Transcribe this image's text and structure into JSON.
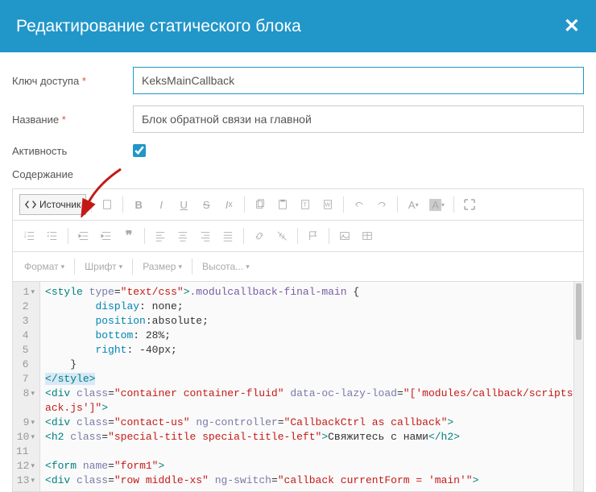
{
  "header": {
    "title": "Редактирование статического блока"
  },
  "fields": {
    "accessKey": {
      "label": "Ключ доступа",
      "required": true,
      "value": "KeksMainCallback"
    },
    "name": {
      "label": "Название",
      "required": true,
      "value": "Блок обратной связи на главной"
    },
    "active": {
      "label": "Активность",
      "checked": true
    },
    "content": {
      "label": "Содержание"
    }
  },
  "toolbar": {
    "source": "Источник",
    "format": "Формат",
    "font": "Шрифт",
    "size": "Размер",
    "height": "Высота..."
  },
  "code": {
    "lines": [
      {
        "n": "1",
        "fold": true,
        "html": "<span class='c-tag'>&lt;style</span> <span class='c-attr'>type</span>=<span class='c-str'>\"text/css\"</span><span class='c-tag'>&gt;</span><span class='c-sel2'>.modulcallback-final-main</span> {"
      },
      {
        "n": "2",
        "html": "        <span class='c-prop'>display</span>: none;"
      },
      {
        "n": "3",
        "html": "        <span class='c-prop'>position</span>:absolute;"
      },
      {
        "n": "4",
        "html": "        <span class='c-prop'>bottom</span>: 28%;"
      },
      {
        "n": "5",
        "html": "        <span class='c-prop'>right</span>: -40px;"
      },
      {
        "n": "6",
        "html": "    }"
      },
      {
        "n": "7",
        "html": "<span class='sel'><span class='c-tag'>&lt;/style&gt;</span></span>"
      },
      {
        "n": "8",
        "fold": true,
        "html": "<span class='c-tag'>&lt;div</span> <span class='c-attr'>class</span>=<span class='c-str'>\"container container-fluid\"</span> <span class='c-attr'>data-oc-lazy-load</span>=<span class='c-str'>\"['modules/callback/scripts/callb</span>"
      },
      {
        "n": "",
        "html": "<span class='c-str'>ack.js']\"</span><span class='c-tag'>&gt;</span>"
      },
      {
        "n": "9",
        "fold": true,
        "html": "<span class='c-tag'>&lt;div</span> <span class='c-attr'>class</span>=<span class='c-str'>\"contact-us\"</span> <span class='c-attr'>ng-controller</span>=<span class='c-str'>\"CallbackCtrl as callback\"</span><span class='c-tag'>&gt;</span>"
      },
      {
        "n": "10",
        "fold": true,
        "html": "<span class='c-tag'>&lt;h2</span> <span class='c-attr'>class</span>=<span class='c-str'>\"special-title special-title-left\"</span><span class='c-tag'>&gt;</span>Свяжитесь с нами<span class='c-tag'>&lt;/h2&gt;</span>"
      },
      {
        "n": "11",
        "html": ""
      },
      {
        "n": "12",
        "fold": true,
        "html": "<span class='c-tag'>&lt;form</span> <span class='c-attr'>name</span>=<span class='c-str'>\"form1\"</span><span class='c-tag'>&gt;</span>"
      },
      {
        "n": "13",
        "fold": true,
        "html": "<span class='c-tag'>&lt;div</span> <span class='c-attr'>class</span>=<span class='c-str'>\"row middle-xs\"</span> <span class='c-attr'>ng-switch</span>=<span class='c-str'>\"callback currentForm = 'main'\"</span><span class='c-tag'>&gt;</span>"
      }
    ]
  }
}
